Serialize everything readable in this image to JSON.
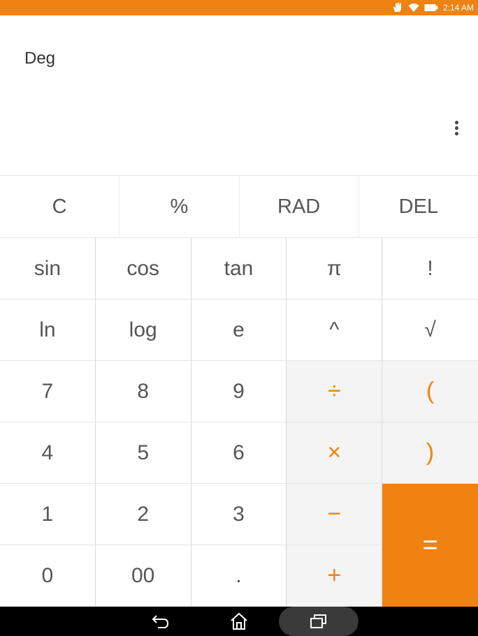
{
  "status_bar": {
    "time": "2:14 AM",
    "icons": [
      "hand-icon",
      "wifi-icon",
      "battery-icon"
    ]
  },
  "display": {
    "angle_mode": "Deg",
    "menu_icon": "overflow-menu-icon"
  },
  "top_row": [
    {
      "name": "clear-button",
      "label": "C"
    },
    {
      "name": "percent-button",
      "label": "%"
    },
    {
      "name": "rad-button",
      "label": "RAD"
    },
    {
      "name": "delete-button",
      "label": "DEL"
    }
  ],
  "keypad": {
    "sin": "sin",
    "cos": "cos",
    "tan": "tan",
    "pi": "π",
    "factorial": "!",
    "ln": "ln",
    "log": "log",
    "e": "e",
    "power": "^",
    "sqrt": "√",
    "d7": "7",
    "d8": "8",
    "d9": "9",
    "divide": "÷",
    "lparen": "(",
    "d4": "4",
    "d5": "5",
    "d6": "6",
    "multiply": "×",
    "rparen": ")",
    "d1": "1",
    "d2": "2",
    "d3": "3",
    "minus": "−",
    "equals": "=",
    "d0": "0",
    "d00": "00",
    "dot": ".",
    "plus": "+"
  },
  "nav_bar": {
    "icons": [
      "back-icon",
      "home-icon",
      "recent-apps-icon"
    ]
  },
  "colors": {
    "accent": "#ef8210",
    "operator_bg": "#f4f4f4"
  }
}
